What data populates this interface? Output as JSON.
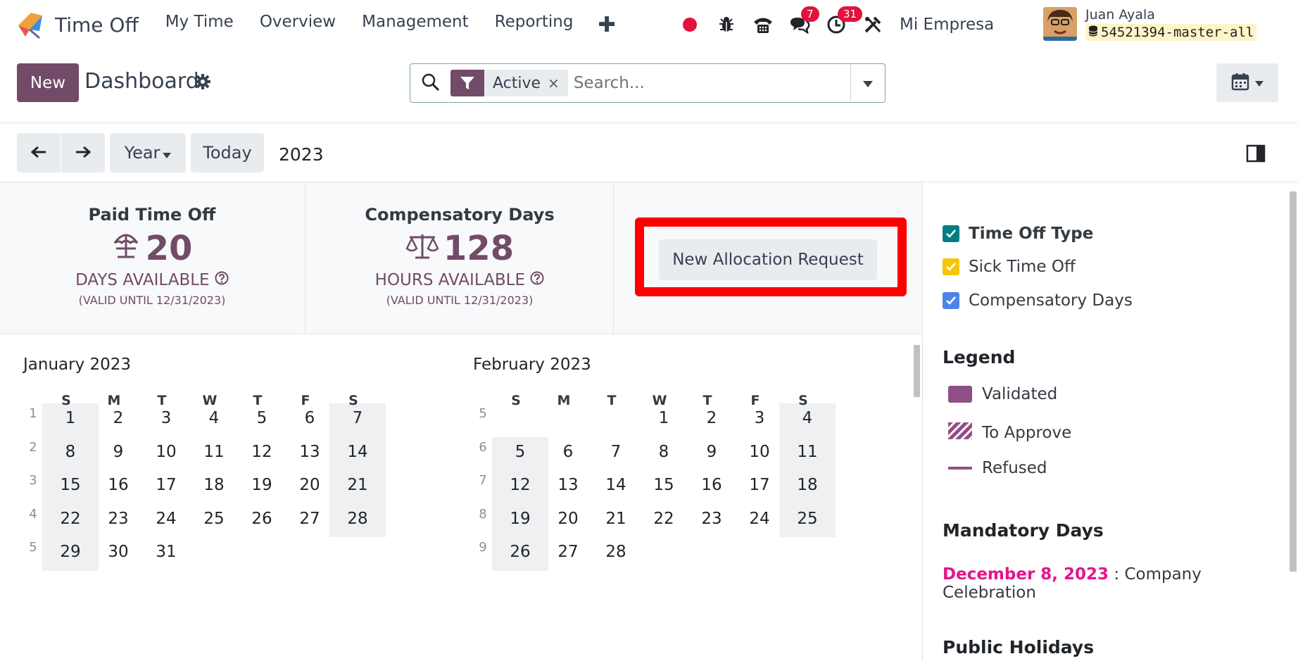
{
  "app": {
    "name": "Time Off"
  },
  "menu": [
    "My Time",
    "Overview",
    "Management",
    "Reporting"
  ],
  "systray": {
    "messages_count": "7",
    "activities_count": "31",
    "company": "Mi Empresa"
  },
  "user": {
    "name": "Juan Ayala",
    "database": "54521394-master-all"
  },
  "control_panel": {
    "new_label": "New",
    "title": "Dashboard"
  },
  "search": {
    "facet": "Active",
    "facet_remove": "×",
    "placeholder": "Search..."
  },
  "toolbar": {
    "period": "Year",
    "today": "Today",
    "current": "2023"
  },
  "stats": [
    {
      "title": "Paid Time Off",
      "value": "20",
      "label": "DAYS AVAILABLE",
      "valid": "(VALID UNTIL 12/31/2023)"
    },
    {
      "title": "Compensatory Days",
      "value": "128",
      "label": "HOURS AVAILABLE",
      "valid": "(VALID UNTIL 12/31/2023)"
    }
  ],
  "allocation_button": "New Allocation Request",
  "calendar": {
    "dow": [
      "S",
      "M",
      "T",
      "W",
      "T",
      "F",
      "S"
    ],
    "months": [
      {
        "title": "January 2023",
        "weeks": [
          1,
          2,
          3,
          4,
          5
        ],
        "start": 0,
        "days": 31
      },
      {
        "title": "February 2023",
        "weeks": [
          5,
          6,
          7,
          8,
          9
        ],
        "start": 3,
        "days": 28
      }
    ]
  },
  "side_panel": {
    "filters": [
      {
        "label": "Time Off Type",
        "color": "#017e84",
        "bold": true
      },
      {
        "label": "Sick Time Off",
        "color": "#f4c609",
        "bold": false
      },
      {
        "label": "Compensatory Days",
        "color": "#4f83e8",
        "bold": false
      }
    ],
    "legend_title": "Legend",
    "legend": [
      "Validated",
      "To Approve",
      "Refused"
    ],
    "mandatory_title": "Mandatory Days",
    "mandatory": {
      "date": "December 8, 2023",
      "name": " : Company Celebration"
    },
    "holidays_title": "Public Holidays"
  },
  "colors": {
    "primary": "#714b67",
    "accent": "#017e84",
    "highlight": "#ff0000"
  }
}
